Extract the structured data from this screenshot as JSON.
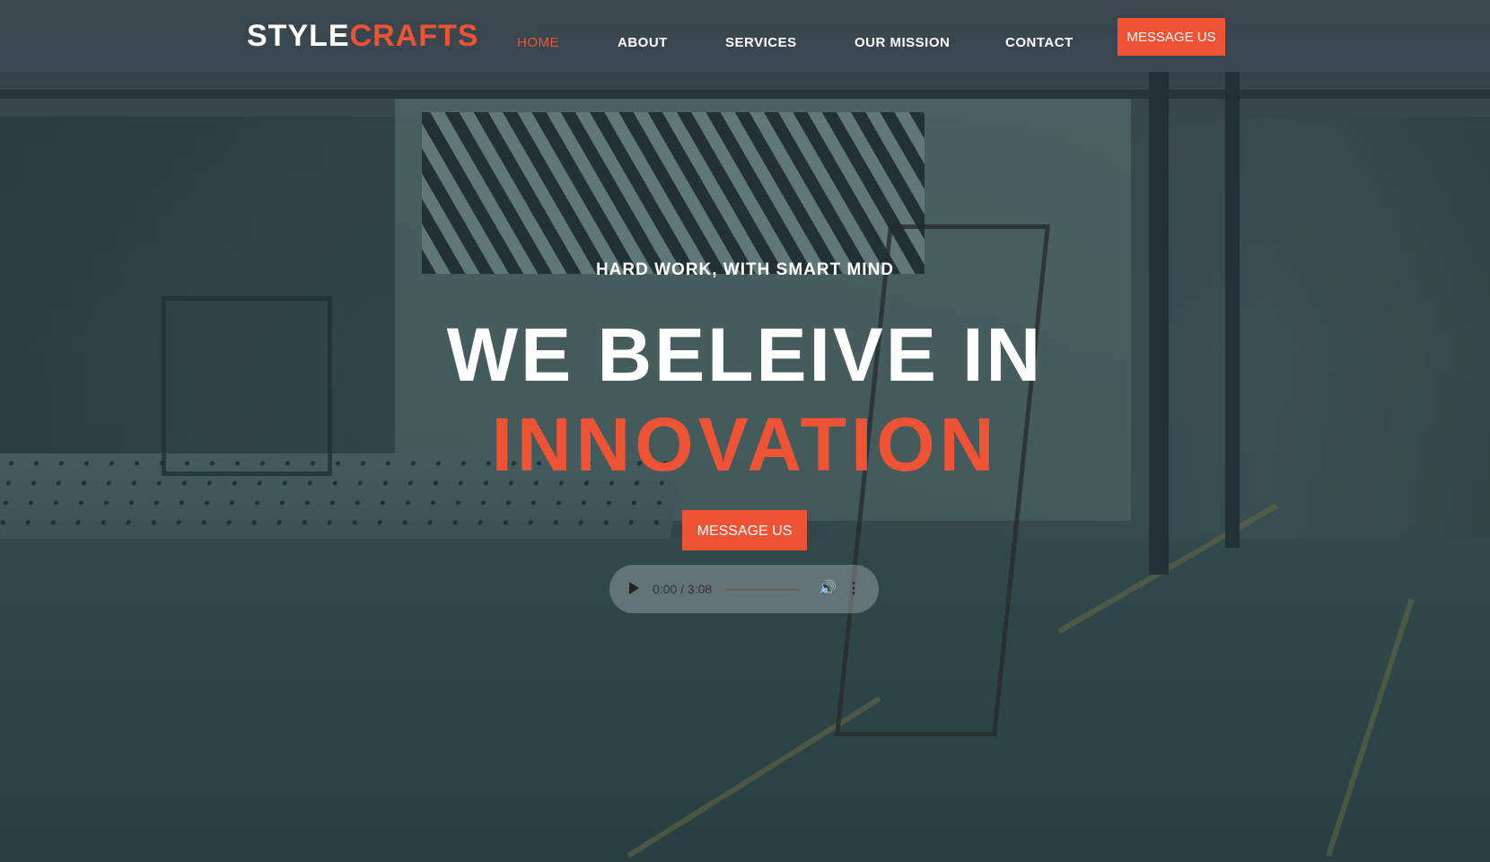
{
  "brand": {
    "logo_primary": "STYLE",
    "logo_accent": "CRAFTS"
  },
  "nav": {
    "items": [
      {
        "label": "HOME",
        "active": true
      },
      {
        "label": "ABOUT"
      },
      {
        "label": "SERVICES"
      },
      {
        "label": "OUR MISSION"
      },
      {
        "label": "CONTACT"
      }
    ],
    "cta_label": "MESSAGE US"
  },
  "hero": {
    "tagline": "HARD WORK, WITH SMART MIND",
    "headline_line1": "WE BELEIVE IN",
    "headline_line2": "INNOVATION",
    "cta_label": "MESSAGE US"
  },
  "audio_player": {
    "time_display": "0:00 / 3:08",
    "play_icon": "play-icon",
    "volume_icon": "volume-icon",
    "more_icon": "more-options-icon",
    "progress": 0
  },
  "colors": {
    "accent": "#ef5336",
    "header_bg": "#3c4650",
    "text_light": "#ffffff"
  }
}
